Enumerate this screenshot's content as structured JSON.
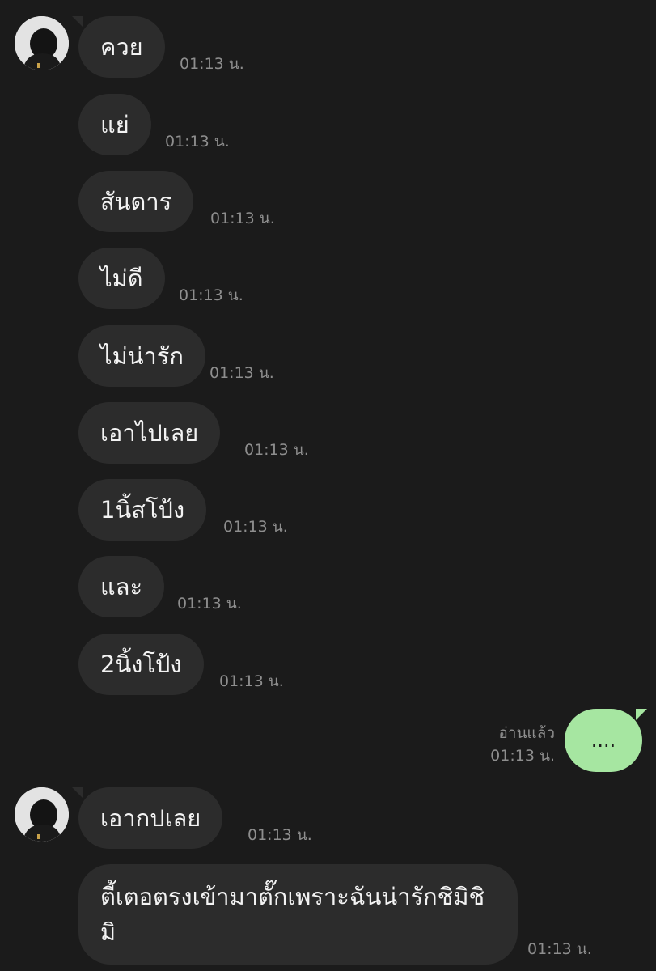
{
  "incoming": [
    {
      "text": "ควย",
      "time": "01:13 น."
    },
    {
      "text": "แย่",
      "time": "01:13 น."
    },
    {
      "text": "สันดาร",
      "time": "01:13 น."
    },
    {
      "text": "ไม่ดี",
      "time": "01:13 น."
    },
    {
      "text": "ไม่น่ารัก",
      "time": "01:13 น."
    },
    {
      "text": "เอาไปเลย",
      "time": "01:13 น."
    },
    {
      "text": "1นิ้สโป้ง",
      "time": "01:13 น."
    },
    {
      "text": "และ",
      "time": "01:13 น."
    },
    {
      "text": "2นิ้งโป้ง",
      "time": "01:13 น."
    }
  ],
  "outgoing": {
    "text": "....",
    "read_label": "อ่านแล้ว",
    "time": "01:13 น."
  },
  "incoming2": [
    {
      "text": "เอากปเลย",
      "time": "01:13 น."
    },
    {
      "text": "ตี้เตอตรงเข้ามาตั๊กเพราะฉันน่ารักชิมิชิมิ",
      "time": "01:13 น."
    }
  ]
}
